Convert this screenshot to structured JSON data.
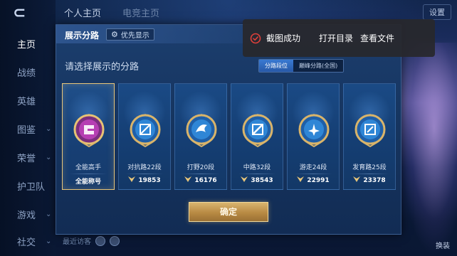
{
  "background": {
    "back_glyph": "⊂",
    "top_tabs": [
      "个人主页",
      "电竞主页"
    ],
    "top_right": [
      "设置"
    ],
    "nav": [
      {
        "label": "主页",
        "active": true,
        "chevron": false
      },
      {
        "label": "战绩",
        "active": false,
        "chevron": false
      },
      {
        "label": "英雄",
        "active": false,
        "chevron": false
      },
      {
        "label": "图鉴",
        "active": false,
        "chevron": true
      },
      {
        "label": "荣誉",
        "active": false,
        "chevron": true
      },
      {
        "label": "护卫队",
        "active": false,
        "chevron": true
      },
      {
        "label": "游戏",
        "active": false,
        "chevron": true
      },
      {
        "label": "社交",
        "active": false,
        "chevron": true
      }
    ],
    "bottom_left_text": "最近访客",
    "right_bottom_label": "换装"
  },
  "panel": {
    "title": "展示分路",
    "priority_label": "优先显示",
    "prompt": "请选择展示的分路",
    "segments": [
      {
        "label": "分路段位",
        "active": true
      },
      {
        "label": "巅峰分路(全国)",
        "active": false
      }
    ],
    "cards": [
      {
        "label": "全能高手",
        "value": "全能称号",
        "selected": true,
        "emblem": "allround-emblem",
        "show_rank_icon": false
      },
      {
        "label": "对抗路22段",
        "value": "19853",
        "selected": false,
        "emblem": "clash-lane-emblem",
        "show_rank_icon": true
      },
      {
        "label": "打野20段",
        "value": "16176",
        "selected": false,
        "emblem": "jungle-emblem",
        "show_rank_icon": true
      },
      {
        "label": "中路32段",
        "value": "38543",
        "selected": false,
        "emblem": "mid-lane-emblem",
        "show_rank_icon": true
      },
      {
        "label": "游走24段",
        "value": "22991",
        "selected": false,
        "emblem": "roam-emblem",
        "show_rank_icon": true
      },
      {
        "label": "发育路25段",
        "value": "23378",
        "selected": false,
        "emblem": "farm-lane-emblem",
        "show_rank_icon": true
      }
    ],
    "confirm_label": "确定"
  },
  "toast": {
    "icon": "check-circle-icon",
    "message": "截图成功",
    "actions": [
      "打开目录",
      "查看文件"
    ]
  },
  "colors": {
    "accent_gold": "#e8c67a",
    "panel_blue": "#163560",
    "toast_bg": "#28282c",
    "toast_icon_red": "#e0403a"
  }
}
